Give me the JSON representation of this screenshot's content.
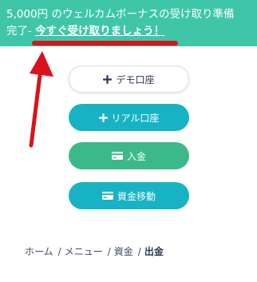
{
  "banner": {
    "line1": "5,000円 のウェルカムボーナスの受け取り準備",
    "line2_prefix": "完了- ",
    "cta": "今すぐ受け取りましょう！"
  },
  "buttons": {
    "demo": "デモ口座",
    "real": "リアル口座",
    "deposit": "入金",
    "transfer": "資金移動"
  },
  "breadcrumb": {
    "items": [
      "ホーム",
      "メニュー",
      "資金"
    ],
    "current": "出金",
    "separator": "/"
  },
  "colors": {
    "banner_bg": "#3fc6a8",
    "annotation": "#d9131b",
    "teal": "#17b3c4",
    "green": "#3cb98a"
  },
  "icons": {
    "demo": "plus-icon",
    "real": "plus-icon",
    "deposit": "card-icon",
    "transfer": "card-icon"
  }
}
